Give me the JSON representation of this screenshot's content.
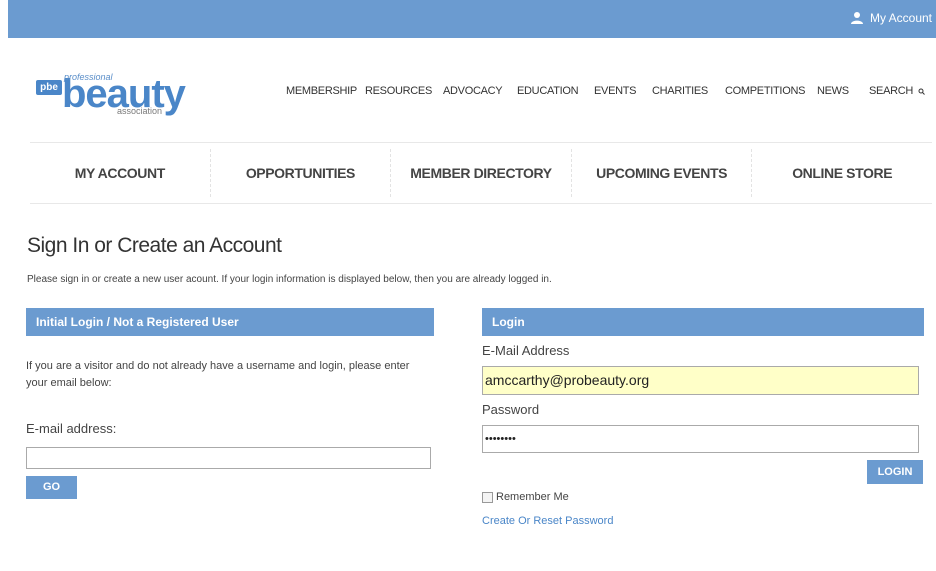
{
  "topbar": {
    "account_label": "My Account"
  },
  "logo": {
    "badge": "pbe",
    "professional": "professional",
    "beauty": "beauty",
    "association": "association"
  },
  "main_nav": [
    "MEMBERSHIP",
    "RESOURCES",
    "ADVOCACY",
    "EDUCATION",
    "EVENTS",
    "CHARITIES",
    "COMPETITIONS",
    "NEWS",
    "SEARCH"
  ],
  "sub_nav": [
    "MY ACCOUNT",
    "OPPORTUNITIES",
    "MEMBER DIRECTORY",
    "UPCOMING EVENTS",
    "ONLINE STORE"
  ],
  "page": {
    "title": "Sign In or Create an Account",
    "intro": "Please sign in or create a new user acount. If your login information is displayed below, then you are already logged in."
  },
  "left_panel": {
    "heading": "Initial Login / Not a Registered User",
    "text": "If you are a visitor and do not already have a username and login, please enter your email below:",
    "email_label": "E-mail address:",
    "email_value": "",
    "go_label": "GO"
  },
  "right_panel": {
    "heading": "Login",
    "email_label": "E-Mail Address",
    "email_value": "amccarthy@probeauty.org",
    "password_label": "Password",
    "password_value": "••••••••",
    "login_label": "LOGIN",
    "remember_label": "Remember Me",
    "reset_link": "Create Or Reset Password"
  },
  "colors": {
    "accent": "#6b9bd0",
    "brand_blue": "#4a86c8",
    "autofill": "#ffffc8"
  }
}
